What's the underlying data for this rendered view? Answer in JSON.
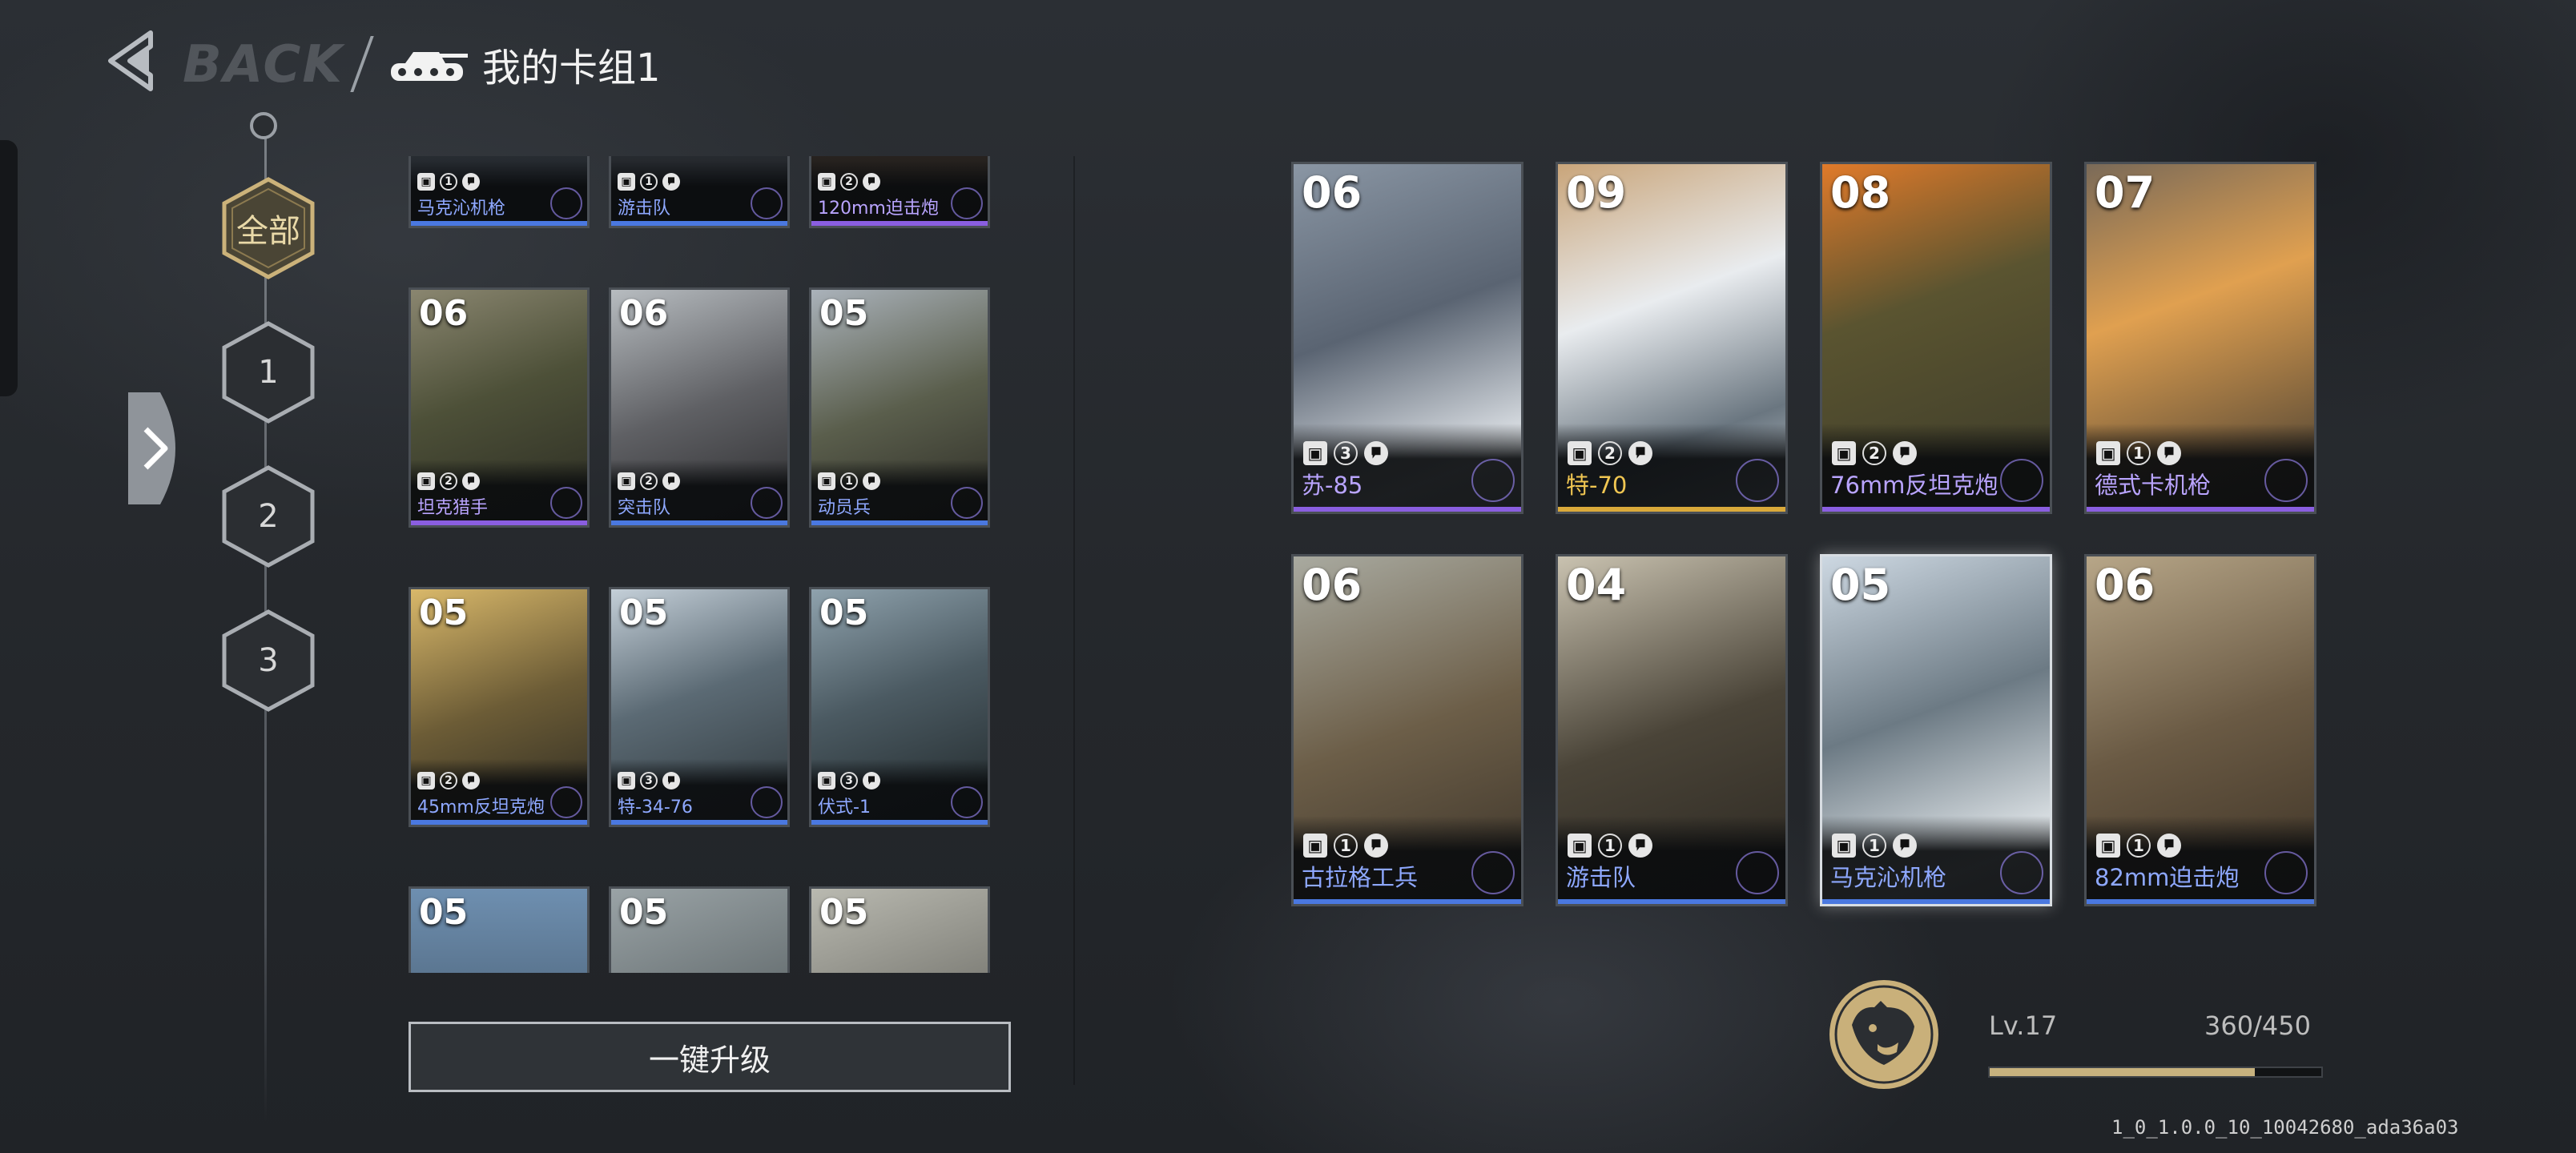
{
  "header": {
    "back_label": "BACK",
    "title": "我的卡组1"
  },
  "deck_filter": {
    "tabs": [
      {
        "label": "全部",
        "active": true
      },
      {
        "label": "1",
        "active": false
      },
      {
        "label": "2",
        "active": false
      },
      {
        "label": "3",
        "active": false
      }
    ]
  },
  "library": {
    "cards": [
      {
        "cost": "",
        "name": "马克沁机枪",
        "type_icon": "machine-gun-icon",
        "count": "1",
        "name_color": "#8ea8ff",
        "bar_color": "#4a78e0"
      },
      {
        "cost": "",
        "name": "游击队",
        "type_icon": "infantry-icon",
        "count": "1",
        "name_color": "#8ea8ff",
        "bar_color": "#4a78e0"
      },
      {
        "cost": "",
        "name": "120mm迫击炮",
        "type_icon": "mortar-icon",
        "count": "2",
        "name_color": "#b9a4ff",
        "bar_color": "#8a5ee0"
      },
      {
        "cost": "06",
        "name": "坦克猎手",
        "type_icon": "infantry-icon",
        "count": "2",
        "name_color": "#b9a4ff",
        "bar_color": "#8a5ee0"
      },
      {
        "cost": "06",
        "name": "突击队",
        "type_icon": "infantry-icon",
        "count": "2",
        "name_color": "#8ea8ff",
        "bar_color": "#4a78e0"
      },
      {
        "cost": "05",
        "name": "动员兵",
        "type_icon": "infantry-icon",
        "count": "1",
        "name_color": "#8ea8ff",
        "bar_color": "#4a78e0"
      },
      {
        "cost": "05",
        "name": "45mm反坦克炮",
        "type_icon": "artillery-icon",
        "count": "2",
        "name_color": "#8ea8ff",
        "bar_color": "#4a78e0"
      },
      {
        "cost": "05",
        "name": "特-34-76",
        "type_icon": "tank-icon",
        "count": "3",
        "name_color": "#8ea8ff",
        "bar_color": "#4a78e0"
      },
      {
        "cost": "05",
        "name": "伏式-1",
        "type_icon": "tank-icon",
        "count": "3",
        "name_color": "#8ea8ff",
        "bar_color": "#4a78e0"
      },
      {
        "cost": "05",
        "name": "",
        "type_icon": "",
        "count": "",
        "name_color": "#8ea8ff",
        "bar_color": "#4a78e0"
      },
      {
        "cost": "05",
        "name": "",
        "type_icon": "",
        "count": "",
        "name_color": "#8ea8ff",
        "bar_color": "#4a78e0"
      },
      {
        "cost": "05",
        "name": "",
        "type_icon": "",
        "count": "",
        "name_color": "#8ea8ff",
        "bar_color": "#4a78e0"
      }
    ],
    "upgrade_all_label": "一键升级"
  },
  "deck": {
    "cards": [
      {
        "cost": "06",
        "name": "苏-85",
        "type_icon": "tank-icon",
        "count": "3",
        "name_color": "#b9a4ff",
        "bar_color": "#8a5ee0"
      },
      {
        "cost": "09",
        "name": "特-70",
        "type_icon": "tank-icon",
        "count": "2",
        "name_color": "#f0c652",
        "bar_color": "#d9a93a"
      },
      {
        "cost": "08",
        "name": "76mm反坦克炮",
        "type_icon": "artillery-icon",
        "count": "2",
        "name_color": "#b9a4ff",
        "bar_color": "#8a5ee0"
      },
      {
        "cost": "07",
        "name": "德式卡机枪",
        "type_icon": "machine-gun-icon",
        "count": "1",
        "name_color": "#b9a4ff",
        "bar_color": "#8a5ee0"
      },
      {
        "cost": "06",
        "name": "古拉格工兵",
        "type_icon": "engineer-icon",
        "count": "1",
        "name_color": "#8ea8ff",
        "bar_color": "#4a78e0"
      },
      {
        "cost": "04",
        "name": "游击队",
        "type_icon": "infantry-icon",
        "count": "1",
        "name_color": "#8ea8ff",
        "bar_color": "#4a78e0"
      },
      {
        "cost": "05",
        "name": "马克沁机枪",
        "type_icon": "machine-gun-icon",
        "count": "1",
        "name_color": "#8ea8ff",
        "bar_color": "#4a78e0"
      },
      {
        "cost": "06",
        "name": "82mm迫击炮",
        "type_icon": "mortar-icon",
        "count": "1",
        "name_color": "#8ea8ff",
        "bar_color": "#4a78e0"
      }
    ]
  },
  "level": {
    "label": "Lv.17",
    "xp_text": "360/450",
    "progress": 0.8,
    "accent": "#c7b27e"
  },
  "build_id": "1_0_1.0.0_10_10042680_ada36a03"
}
